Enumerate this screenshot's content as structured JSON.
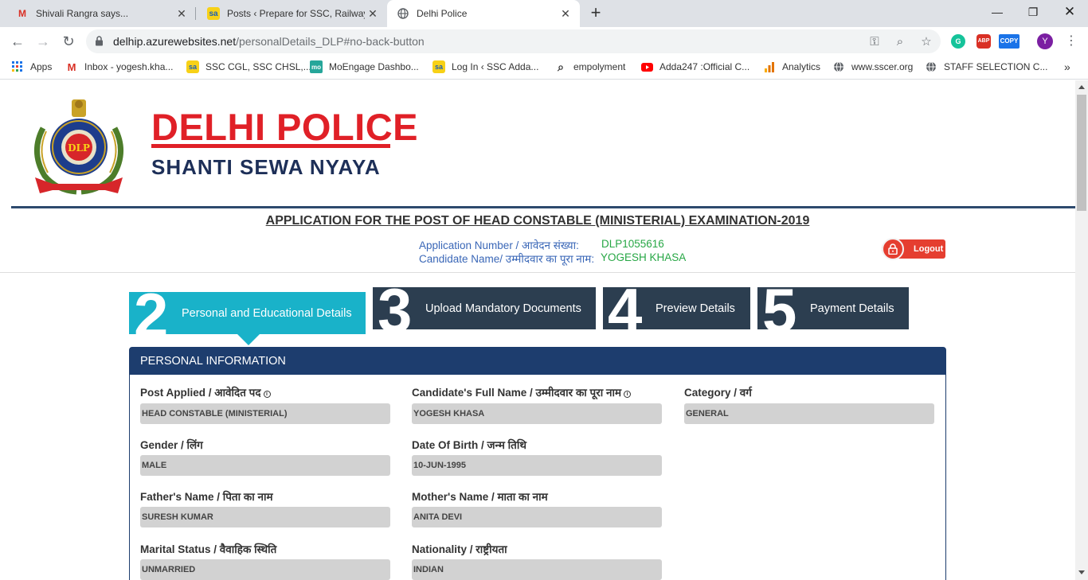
{
  "browser": {
    "tabs": [
      {
        "title": "Shivali Rangra says...",
        "icon": "gmail-icon"
      },
      {
        "title": "Posts ‹ Prepare for SSC, Railway &",
        "icon": "sa-icon"
      },
      {
        "title": "Delhi Police",
        "icon": "globe-icon"
      }
    ],
    "url_host": "delhip.azurewebsites.net",
    "url_path": "/personalDetails_DLP#no-back-button",
    "extensions": {
      "g": "G",
      "abp": "ABP",
      "copy": "COPY",
      "profile": "Y"
    },
    "bookmarks": [
      {
        "label": "Apps",
        "icon": "apps-grid-icon"
      },
      {
        "label": "Inbox - yogesh.kha...",
        "icon": "gmail-icon"
      },
      {
        "label": "SSC CGL, SSC CHSL,...",
        "icon": "sa-icon"
      },
      {
        "label": "MoEngage Dashbo...",
        "icon": "moengage-icon"
      },
      {
        "label": "Log In ‹ SSC Adda...",
        "icon": "sa-icon"
      },
      {
        "label": "empolyment",
        "icon": "search-icon"
      },
      {
        "label": "Adda247 :Official C...",
        "icon": "youtube-icon"
      },
      {
        "label": "Analytics",
        "icon": "analytics-icon"
      },
      {
        "label": "www.sscer.org",
        "icon": "globe-icon"
      },
      {
        "label": "STAFF SELECTION C...",
        "icon": "globe-icon"
      }
    ]
  },
  "header": {
    "brand_title": "DELHI POLICE",
    "brand_subtitle": "SHANTI  SEWA NYAYA",
    "emblem_text": "DLP",
    "application_title": "APPLICATION FOR THE POST OF HEAD CONSTABLE (MINISTERIAL) EXAMINATION-2019",
    "application_number_label": "Application Number / आवेदन संख्या:",
    "application_number": "DLP1055616",
    "candidate_name_label": "Candidate Name/ उम्मीदवार का पूरा नाम:",
    "candidate_name": "YOGESH KHASA",
    "logout_label": "Logout"
  },
  "steps": [
    {
      "num": "2",
      "label": "Personal and Educational Details",
      "active": true
    },
    {
      "num": "3",
      "label": "Upload Mandatory Documents"
    },
    {
      "num": "4",
      "label": "Preview Details"
    },
    {
      "num": "5",
      "label": "Payment Details"
    }
  ],
  "personal": {
    "heading": "PERSONAL INFORMATION",
    "post_applied": {
      "label": "Post Applied / आवेदित पद",
      "value": "HEAD CONSTABLE (MINISTERIAL)"
    },
    "full_name": {
      "label": "Candidate's Full Name / उम्मीदवार का पूरा नाम",
      "value": "YOGESH KHASA"
    },
    "category": {
      "label": "Category / वर्ग",
      "value": "GENERAL"
    },
    "gender": {
      "label": "Gender / लिंग",
      "value": "MALE"
    },
    "dob": {
      "label": "Date Of Birth / जन्म तिथि",
      "value": "10-JUN-1995"
    },
    "father": {
      "label": "Father's Name / पिता का नाम",
      "value": "SURESH KUMAR"
    },
    "mother": {
      "label": "Mother's Name / माता का नाम",
      "value": "ANITA DEVI"
    },
    "marital": {
      "label": "Marital Status / वैवाहिक स्थिति",
      "value": "UNMARRIED"
    },
    "nationality": {
      "label": "Nationality / राष्ट्रीयता",
      "value": "INDIAN"
    }
  },
  "colors": {
    "brand_red": "#e02027",
    "navy": "#1d3d6e",
    "step_dark": "#2c3e50",
    "step_active": "#19b2c9",
    "link_blue": "#3a67b7",
    "value_green": "#27a745"
  }
}
